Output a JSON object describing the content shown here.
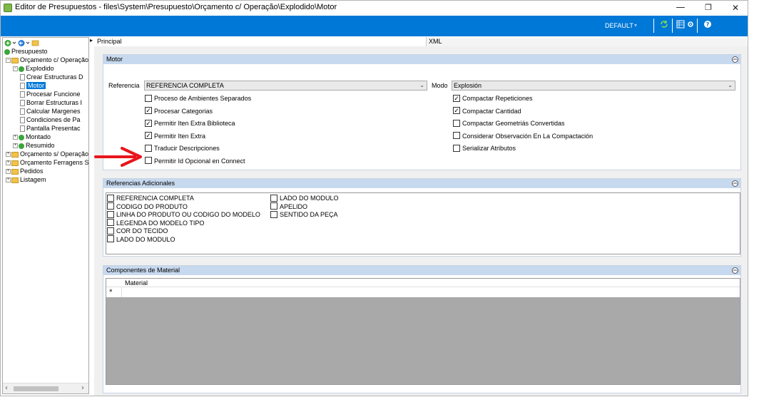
{
  "window": {
    "title": "Editor de Presupuestos - files\\System\\Presupuesto\\Orçamento c/ Operação\\Explodido\\Motor",
    "minimize": "—",
    "maximize": "❐",
    "close": "✕"
  },
  "toolbar": {
    "profile_label": "DEFAULT",
    "profile_arrow": "▾",
    "accent": "#0078d7"
  },
  "left_panel": {
    "tools": [
      "add-icon",
      "dropdown-arrow",
      "back-icon",
      "dropdown-arrow",
      "folder-icon"
    ],
    "tree": [
      {
        "label": "Presupuesto",
        "icon": "green"
      },
      {
        "label": "Orçamento c/ Operação",
        "icon": "folder"
      },
      {
        "label": "Explodido",
        "icon": "green"
      },
      {
        "label": "Crear Estructuras D",
        "icon": "doc"
      },
      {
        "label": "Motor",
        "icon": "doc"
      },
      {
        "label": "Procesar Funcione",
        "icon": "doc"
      },
      {
        "label": "Borrar Estructuras I",
        "icon": "doc"
      },
      {
        "label": "Calcular Margenes",
        "icon": "doc"
      },
      {
        "label": "Condiciones de Pa",
        "icon": "doc"
      },
      {
        "label": "Pantalla Presentac",
        "icon": "doc"
      },
      {
        "label": "Montado",
        "icon": "green"
      },
      {
        "label": "Resumido",
        "icon": "green"
      },
      {
        "label": "Orçamento s/ Operação",
        "icon": "folder"
      },
      {
        "label": "Orçamento Ferragens S",
        "icon": "folder"
      },
      {
        "label": "Pedidos",
        "icon": "folder"
      },
      {
        "label": "Listagem",
        "icon": "folder"
      }
    ],
    "selected": "Motor"
  },
  "tabs": {
    "principal": "Principal",
    "xml": "XML"
  },
  "motor": {
    "header": "Motor",
    "referencia_label": "Referencia",
    "referencia_value": "REFERENCIA COMPLETA",
    "modo_label": "Modo",
    "modo_value": "Explosión",
    "left_checks": [
      {
        "label": "Proceso de Ambientes Separados",
        "checked": false
      },
      {
        "label": "Procesar Categorias",
        "checked": true
      },
      {
        "label": "Permitir Iten Extra Biblioteca",
        "checked": true
      },
      {
        "label": "Permitir Iten Extra",
        "checked": true
      },
      {
        "label": "Traducir Descripciones",
        "checked": false
      },
      {
        "label": "Permitir Id Opcional en Connect",
        "checked": false
      }
    ],
    "right_checks": [
      {
        "label": "Compactar Repeticiones",
        "checked": true
      },
      {
        "label": "Compactar Cantidad",
        "checked": true
      },
      {
        "label": "Compactar Geometriás Convertidas",
        "checked": false
      },
      {
        "label": "Considerar Observación En La Compactación",
        "checked": false
      },
      {
        "label": "Serializar Atributos",
        "checked": false
      }
    ]
  },
  "referencias": {
    "header": "Referencias Adicionales",
    "col1": [
      "REFERENCIA COMPLETA",
      "CODIGO DO PRODUTO",
      "LINHA DO PRODUTO OU CODIGO DO MODELO",
      "LEGENDA DO MODELO TIPO",
      "COR DO TECIDO",
      "LADO DO MODULO"
    ],
    "col2": [
      "LADO DO MODULO",
      "APELIDO",
      "SENTIDO DA PEÇA"
    ]
  },
  "componentes": {
    "header": "Componentes de Material",
    "column": "Material",
    "new_row_marker": "*"
  },
  "annotation": {
    "color": "#e8151b"
  }
}
